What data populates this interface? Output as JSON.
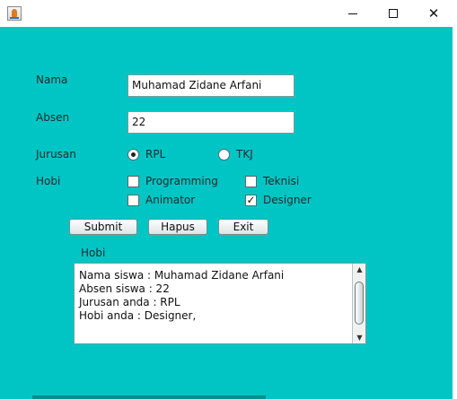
{
  "window": {
    "icon": "java-app-icon",
    "controls": {
      "minimize_icon": "minimize-icon",
      "maximize_icon": "maximize-icon",
      "close_icon": "close-icon",
      "close_glyph": "✕"
    }
  },
  "form": {
    "nama_label": "Nama",
    "nama_value": "Muhamad Zidane Arfani",
    "absen_label": "Absen",
    "absen_value": "22",
    "jurusan_label": "Jurusan",
    "jurusan_options": [
      {
        "label": "RPL",
        "selected": true
      },
      {
        "label": "TKJ",
        "selected": false
      }
    ],
    "hobi_label": "Hobi",
    "hobi_options": [
      {
        "label": "Programming",
        "checked": false
      },
      {
        "label": "Teknisi",
        "checked": false
      },
      {
        "label": "Animator",
        "checked": false
      },
      {
        "label": "Designer",
        "checked": true
      }
    ]
  },
  "buttons": {
    "submit": "Submit",
    "hapus": "Hapus",
    "exit": "Exit"
  },
  "output": {
    "label": "Hobi",
    "text": "Nama siswa : Muhamad Zidane Arfani\nAbsen siswa : 22\nJurusan anda : RPL\nHobi anda : Designer,"
  },
  "colors": {
    "background": "#00c5c5",
    "field_bg": "#ffffff"
  }
}
